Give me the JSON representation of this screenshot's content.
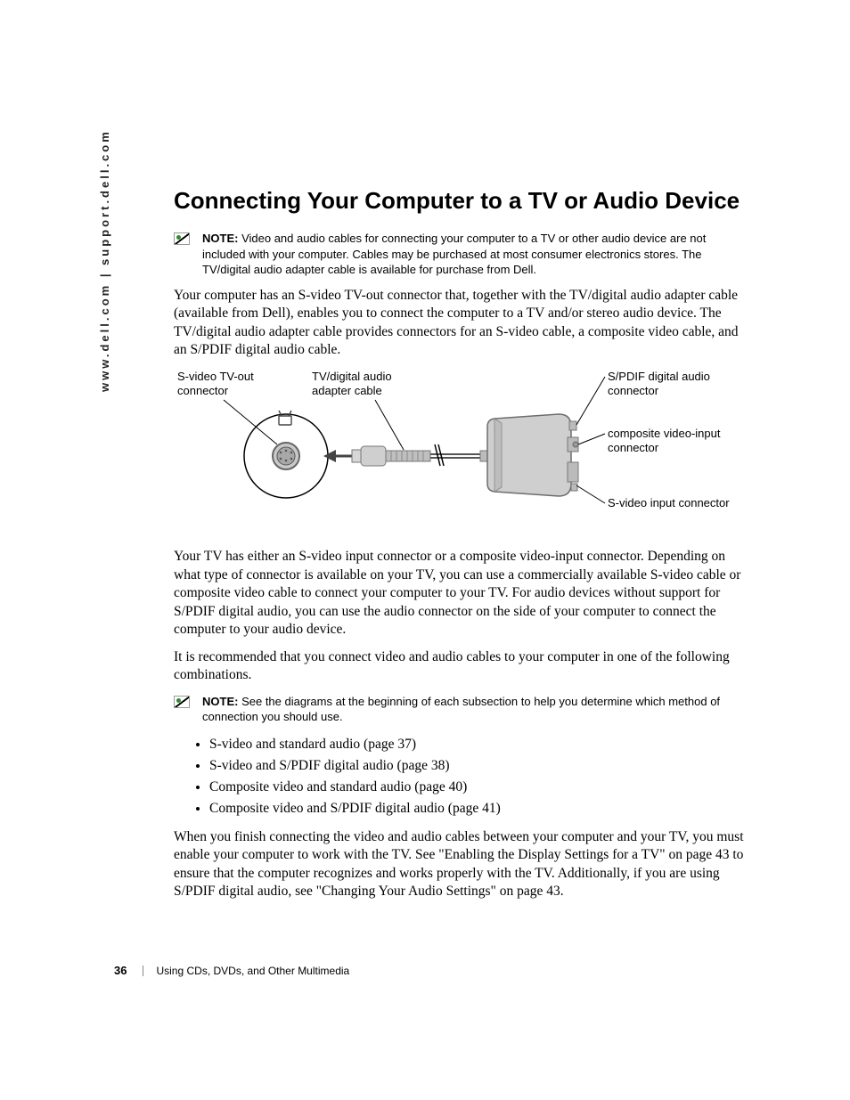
{
  "sidebar_url": "www.dell.com | support.dell.com",
  "heading": "Connecting Your Computer to a TV or Audio Device",
  "note1_label": "NOTE:",
  "note1_body": "Video and audio cables for connecting your computer to a TV or other audio device are not included with your computer. Cables may be purchased at most consumer electronics stores. The TV/digital audio adapter cable is available for purchase from Dell.",
  "para1": "Your computer has an S-video TV-out connector that, together with the TV/digital audio adapter cable (available from Dell), enables you to connect the computer to a TV and/or stereo audio device. The TV/digital audio adapter cable provides connectors for an S-video cable, a composite video cable, and an S/PDIF digital audio cable.",
  "diagram_labels": {
    "svideo_tvout": "S-video TV-out connector",
    "adapter_cable": "TV/digital audio adapter cable",
    "spdif": "S/PDIF digital audio connector",
    "composite": "composite video-input connector",
    "svideo_input": "S-video input connector"
  },
  "para2": "Your TV has either an S-video input connector or a composite video-input connector. Depending on what type of connector is available on your TV, you can use a commercially available S-video cable or composite video cable to connect your computer to your TV. For audio devices without support for S/PDIF digital audio, you can use the audio connector on the side of your computer to connect the computer to your audio device.",
  "para3": "It is recommended that you connect video and audio cables to your computer in one of the following combinations.",
  "note2_label": "NOTE:",
  "note2_body": "See the diagrams at the beginning of each subsection to help you determine which method of connection you should use.",
  "bullets": [
    "S-video and standard audio (page 37)",
    "S-video and S/PDIF digital audio (page 38)",
    "Composite video and standard audio (page 40)",
    "Composite video and S/PDIF digital audio (page 41)"
  ],
  "para4": "When you finish connecting the video and audio cables between your computer and your TV, you must enable your computer to work with the TV. See \"Enabling the Display Settings for a TV\" on page 43 to ensure that the computer recognizes and works properly with the TV. Additionally, if you are using S/PDIF digital audio, see \"Changing Your Audio Settings\" on page 43.",
  "footer": {
    "page_number": "36",
    "chapter": "Using CDs, DVDs, and Other Multimedia"
  }
}
